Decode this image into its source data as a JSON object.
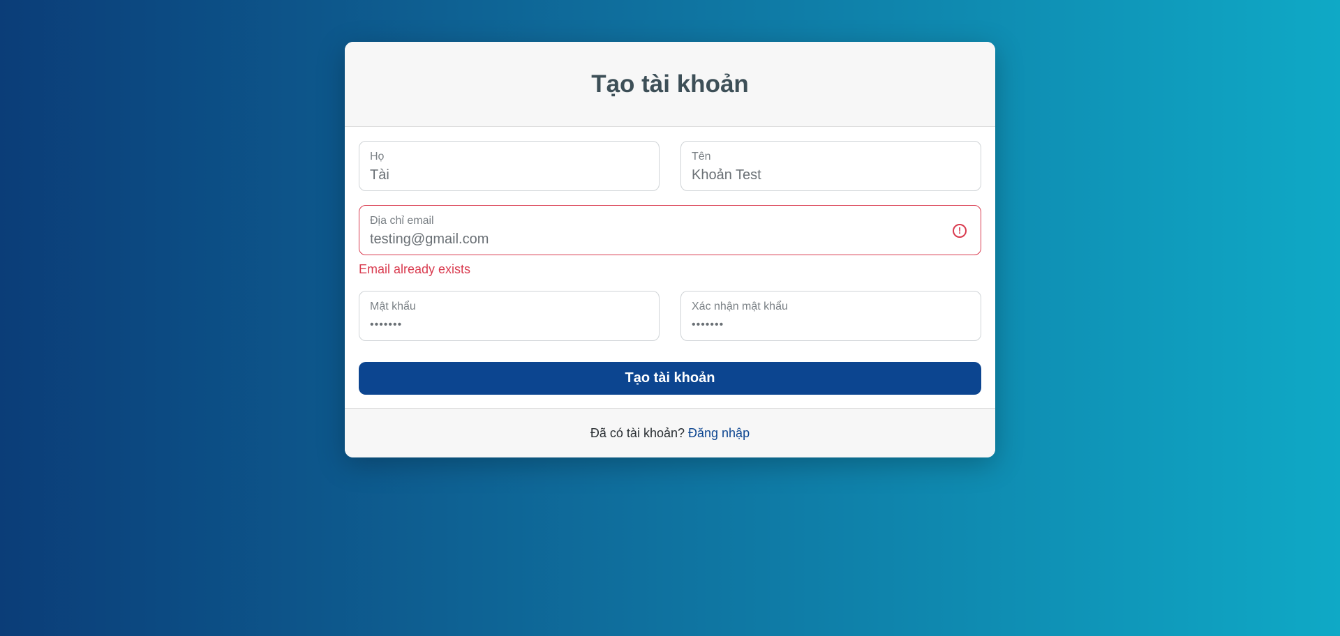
{
  "page": {
    "title": "Tạo tài khoản"
  },
  "form": {
    "last_name": {
      "label": "Họ",
      "value": "Tài"
    },
    "first_name": {
      "label": "Tên",
      "value": "Khoản Test"
    },
    "email": {
      "label": "Địa chỉ email",
      "value": "testing@gmail.com",
      "error": "Email already exists",
      "error_icon": "alert-circle-icon"
    },
    "password": {
      "label": "Mật khẩu",
      "value": "•••••••"
    },
    "confirm_password": {
      "label": "Xác nhận mật khẩu",
      "value": "•••••••"
    },
    "submit_label": "Tạo tài khoản"
  },
  "footer": {
    "prompt": "Đã có tài khoản?",
    "link_label": "Đăng nhập"
  },
  "colors": {
    "primary": "#0c4590",
    "error": "#d93a4e",
    "title": "#3d4f57"
  }
}
